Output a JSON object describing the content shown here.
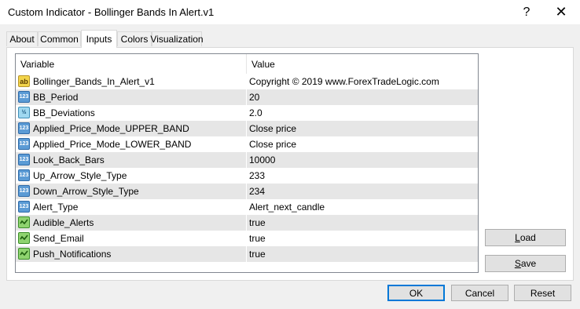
{
  "window": {
    "title": "Custom Indicator - Bollinger Bands In Alert.v1",
    "help_glyph": "?",
    "close_glyph": "✕"
  },
  "tabs": [
    {
      "label": "About",
      "active": false
    },
    {
      "label": "Common",
      "active": false
    },
    {
      "label": "Inputs",
      "active": true
    },
    {
      "label": "Colors",
      "active": false
    },
    {
      "label": "Visualization",
      "active": false
    }
  ],
  "table": {
    "headers": {
      "variable": "Variable",
      "value": "Value"
    },
    "rows": [
      {
        "icon": "string-ab-icon",
        "badge": "ab",
        "name": "Bollinger_Bands_In_Alert_v1",
        "value": "Copyright © 2019 www.ForexTradeLogic.com"
      },
      {
        "icon": "integer-123-icon",
        "badge": "123",
        "name": "BB_Period",
        "value": "20"
      },
      {
        "icon": "double-half-icon",
        "badge": "½",
        "name": "BB_Deviations",
        "value": "2.0"
      },
      {
        "icon": "integer-123-icon",
        "badge": "123",
        "name": "Applied_Price_Mode_UPPER_BAND",
        "value": "Close price"
      },
      {
        "icon": "integer-123-icon",
        "badge": "123",
        "name": "Applied_Price_Mode_LOWER_BAND",
        "value": "Close price"
      },
      {
        "icon": "integer-123-icon",
        "badge": "123",
        "name": "Look_Back_Bars",
        "value": "10000"
      },
      {
        "icon": "integer-123-icon",
        "badge": "123",
        "name": "Up_Arrow_Style_Type",
        "value": "233"
      },
      {
        "icon": "integer-123-icon",
        "badge": "123",
        "name": "Down_Arrow_Style_Type",
        "value": "234"
      },
      {
        "icon": "integer-123-icon",
        "badge": "123",
        "name": "Alert_Type",
        "value": "Alert_next_candle"
      },
      {
        "icon": "boolean-icon",
        "badge": "",
        "name": "Audible_Alerts",
        "value": "true"
      },
      {
        "icon": "boolean-icon",
        "badge": "",
        "name": "Send_Email",
        "value": "true"
      },
      {
        "icon": "boolean-icon",
        "badge": "",
        "name": "Push_Notifications",
        "value": "true"
      }
    ]
  },
  "side_buttons": {
    "load": {
      "mnemonic": "L",
      "rest": "oad"
    },
    "save": {
      "mnemonic": "S",
      "rest": "ave"
    }
  },
  "footer": {
    "ok": "OK",
    "cancel": "Cancel",
    "reset": "Reset"
  },
  "colors": {
    "accent": "#0078d7",
    "row_alt": "#e6e6e6"
  }
}
